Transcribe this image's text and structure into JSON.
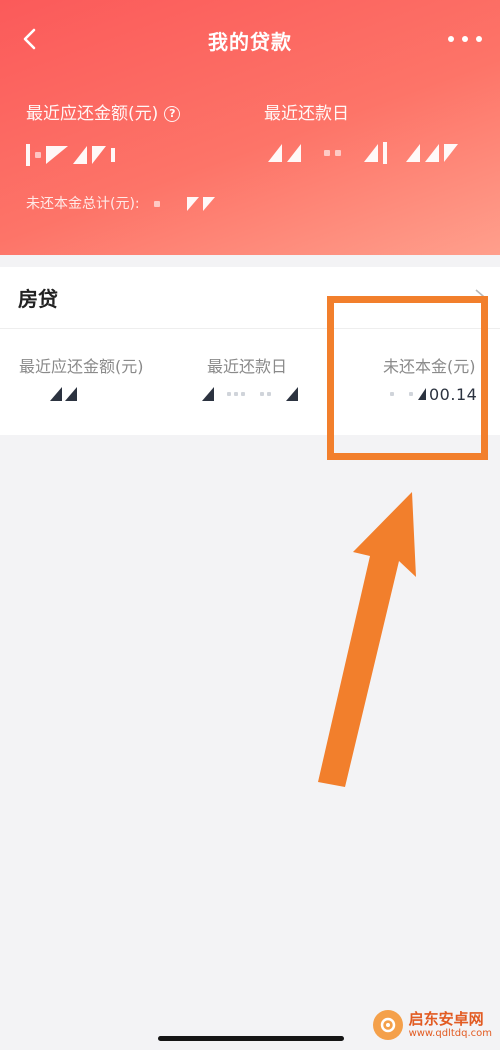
{
  "nav": {
    "title": "我的贷款",
    "back_icon": "chevron-left-icon",
    "more_icon": "more-dots-icon"
  },
  "summary": {
    "recent_amount_label": "最近应还金额(元)",
    "help_icon_glyph": "?",
    "recent_date_label": "最近还款日",
    "unpaid_total_label": "未还本金总计(元):"
  },
  "loan_card": {
    "title": "房贷",
    "columns": [
      {
        "label": "最近应还金额(元)",
        "value": ""
      },
      {
        "label": "最近还款日",
        "value": ""
      },
      {
        "label": "未还本金(元)",
        "value": "00.14"
      }
    ]
  },
  "watermark": {
    "name": "启东安卓网",
    "url": "www.qdltdq.com"
  },
  "colors": {
    "header_start": "#fb5a5a",
    "header_end": "#ff9f8c",
    "highlight": "#f27f2c",
    "value_text": "#2c3340"
  }
}
